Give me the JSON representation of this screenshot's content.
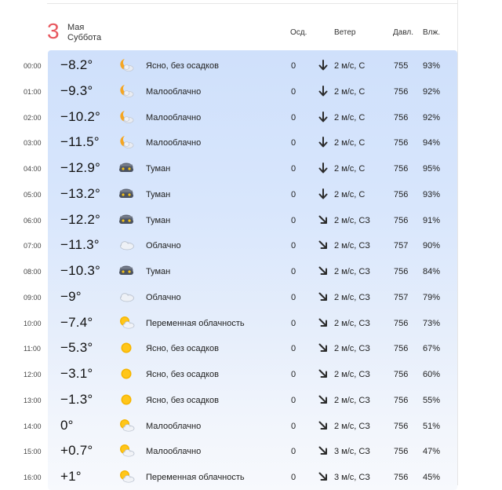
{
  "header": {
    "day_number": "3",
    "month": "Мая",
    "weekday": "Суббота",
    "columns": {
      "precip": "Осд.",
      "wind": "Ветер",
      "pressure": "Давл.",
      "humidity": "Влж."
    }
  },
  "colors": {
    "day_number": "#e8585f",
    "table_top": "#cfe0fb",
    "table_bottom": "#f7f9fd"
  },
  "rows": [
    {
      "time": "00:00",
      "temp": "−8.2°",
      "icon": "moon-cloud-icon",
      "condition": "Ясно, без осадков",
      "precip": "0",
      "wind_dir": "down-arrow-icon",
      "wind": "2 м/с, С",
      "pressure": "755",
      "humidity": "93%"
    },
    {
      "time": "01:00",
      "temp": "−9.3°",
      "icon": "moon-cloud-icon",
      "condition": "Малооблачно",
      "precip": "0",
      "wind_dir": "down-arrow-icon",
      "wind": "2 м/с, С",
      "pressure": "756",
      "humidity": "92%"
    },
    {
      "time": "02:00",
      "temp": "−10.2°",
      "icon": "moon-cloud-icon",
      "condition": "Малооблачно",
      "precip": "0",
      "wind_dir": "down-arrow-icon",
      "wind": "2 м/с, С",
      "pressure": "756",
      "humidity": "92%"
    },
    {
      "time": "03:00",
      "temp": "−11.5°",
      "icon": "moon-cloud-icon",
      "condition": "Малооблачно",
      "precip": "0",
      "wind_dir": "down-arrow-icon",
      "wind": "2 м/с, С",
      "pressure": "756",
      "humidity": "94%"
    },
    {
      "time": "04:00",
      "temp": "−12.9°",
      "icon": "fog-icon",
      "condition": "Туман",
      "precip": "0",
      "wind_dir": "down-arrow-icon",
      "wind": "2 м/с, С",
      "pressure": "756",
      "humidity": "95%"
    },
    {
      "time": "05:00",
      "temp": "−13.2°",
      "icon": "fog-icon",
      "condition": "Туман",
      "precip": "0",
      "wind_dir": "down-arrow-icon",
      "wind": "2 м/с, С",
      "pressure": "756",
      "humidity": "93%"
    },
    {
      "time": "06:00",
      "temp": "−12.2°",
      "icon": "fog-icon",
      "condition": "Туман",
      "precip": "0",
      "wind_dir": "down-right-arrow-icon",
      "wind": "2 м/с, СЗ",
      "pressure": "756",
      "humidity": "91%"
    },
    {
      "time": "07:00",
      "temp": "−11.3°",
      "icon": "cloud-icon",
      "condition": "Облачно",
      "precip": "0",
      "wind_dir": "down-right-arrow-icon",
      "wind": "2 м/с, СЗ",
      "pressure": "757",
      "humidity": "90%"
    },
    {
      "time": "08:00",
      "temp": "−10.3°",
      "icon": "fog-icon",
      "condition": "Туман",
      "precip": "0",
      "wind_dir": "down-right-arrow-icon",
      "wind": "2 м/с, СЗ",
      "pressure": "756",
      "humidity": "84%"
    },
    {
      "time": "09:00",
      "temp": "−9°",
      "icon": "cloud-icon",
      "condition": "Облачно",
      "precip": "0",
      "wind_dir": "down-right-arrow-icon",
      "wind": "2 м/с, СЗ",
      "pressure": "757",
      "humidity": "79%"
    },
    {
      "time": "10:00",
      "temp": "−7.4°",
      "icon": "sun-cloud-icon",
      "condition": "Переменная облачность",
      "precip": "0",
      "wind_dir": "down-right-arrow-icon",
      "wind": "2 м/с, СЗ",
      "pressure": "756",
      "humidity": "73%"
    },
    {
      "time": "11:00",
      "temp": "−5.3°",
      "icon": "sun-icon",
      "condition": "Ясно, без осадков",
      "precip": "0",
      "wind_dir": "down-right-arrow-icon",
      "wind": "2 м/с, СЗ",
      "pressure": "756",
      "humidity": "67%"
    },
    {
      "time": "12:00",
      "temp": "−3.1°",
      "icon": "sun-icon",
      "condition": "Ясно, без осадков",
      "precip": "0",
      "wind_dir": "down-right-arrow-icon",
      "wind": "2 м/с, СЗ",
      "pressure": "756",
      "humidity": "60%"
    },
    {
      "time": "13:00",
      "temp": "−1.3°",
      "icon": "sun-icon",
      "condition": "Ясно, без осадков",
      "precip": "0",
      "wind_dir": "down-right-arrow-icon",
      "wind": "2 м/с, СЗ",
      "pressure": "756",
      "humidity": "55%"
    },
    {
      "time": "14:00",
      "temp": "0°",
      "icon": "sun-cloud-icon",
      "condition": "Малооблачно",
      "precip": "0",
      "wind_dir": "down-right-arrow-icon",
      "wind": "2 м/с, СЗ",
      "pressure": "756",
      "humidity": "51%"
    },
    {
      "time": "15:00",
      "temp": "+0.7°",
      "icon": "sun-cloud-icon",
      "condition": "Малооблачно",
      "precip": "0",
      "wind_dir": "down-right-arrow-icon",
      "wind": "3 м/с, СЗ",
      "pressure": "756",
      "humidity": "47%"
    },
    {
      "time": "16:00",
      "temp": "+1°",
      "icon": "sun-cloud-icon",
      "condition": "Переменная облачность",
      "precip": "0",
      "wind_dir": "down-right-arrow-icon",
      "wind": "3 м/с, СЗ",
      "pressure": "756",
      "humidity": "45%"
    }
  ]
}
